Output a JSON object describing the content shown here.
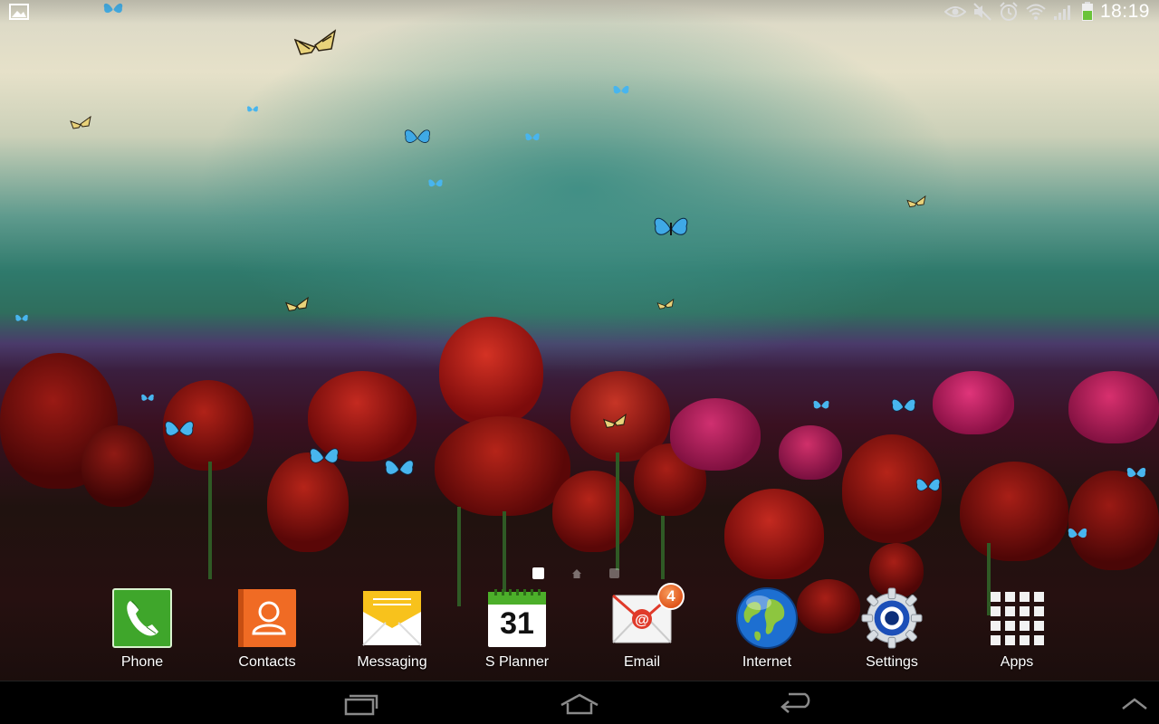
{
  "status_bar": {
    "time": "18:19",
    "icons": [
      "gallery-notification-icon",
      "eye-icon",
      "mute-icon",
      "alarm-icon",
      "wifi-icon",
      "signal-icon",
      "battery-icon"
    ]
  },
  "home_screen": {
    "pages": 3,
    "current_page": 1
  },
  "dock": {
    "apps": [
      {
        "label": "Phone",
        "icon": "phone-icon"
      },
      {
        "label": "Contacts",
        "icon": "contacts-icon"
      },
      {
        "label": "Messaging",
        "icon": "messaging-icon"
      },
      {
        "label": "S Planner",
        "icon": "calendar-icon",
        "date": "31"
      },
      {
        "label": "Email",
        "icon": "email-icon",
        "badge": "4"
      },
      {
        "label": "Internet",
        "icon": "globe-icon"
      },
      {
        "label": "Settings",
        "icon": "settings-icon"
      },
      {
        "label": "Apps",
        "icon": "apps-grid-icon"
      }
    ]
  },
  "navigation": {
    "buttons": [
      "recent-apps-icon",
      "home-icon",
      "back-icon",
      "expand-up-icon"
    ]
  },
  "colors": {
    "phone_green": "#3fa62b",
    "contacts_orange": "#f06b24",
    "badge_orange": "#e0561c",
    "nav_bar": "#000000"
  }
}
